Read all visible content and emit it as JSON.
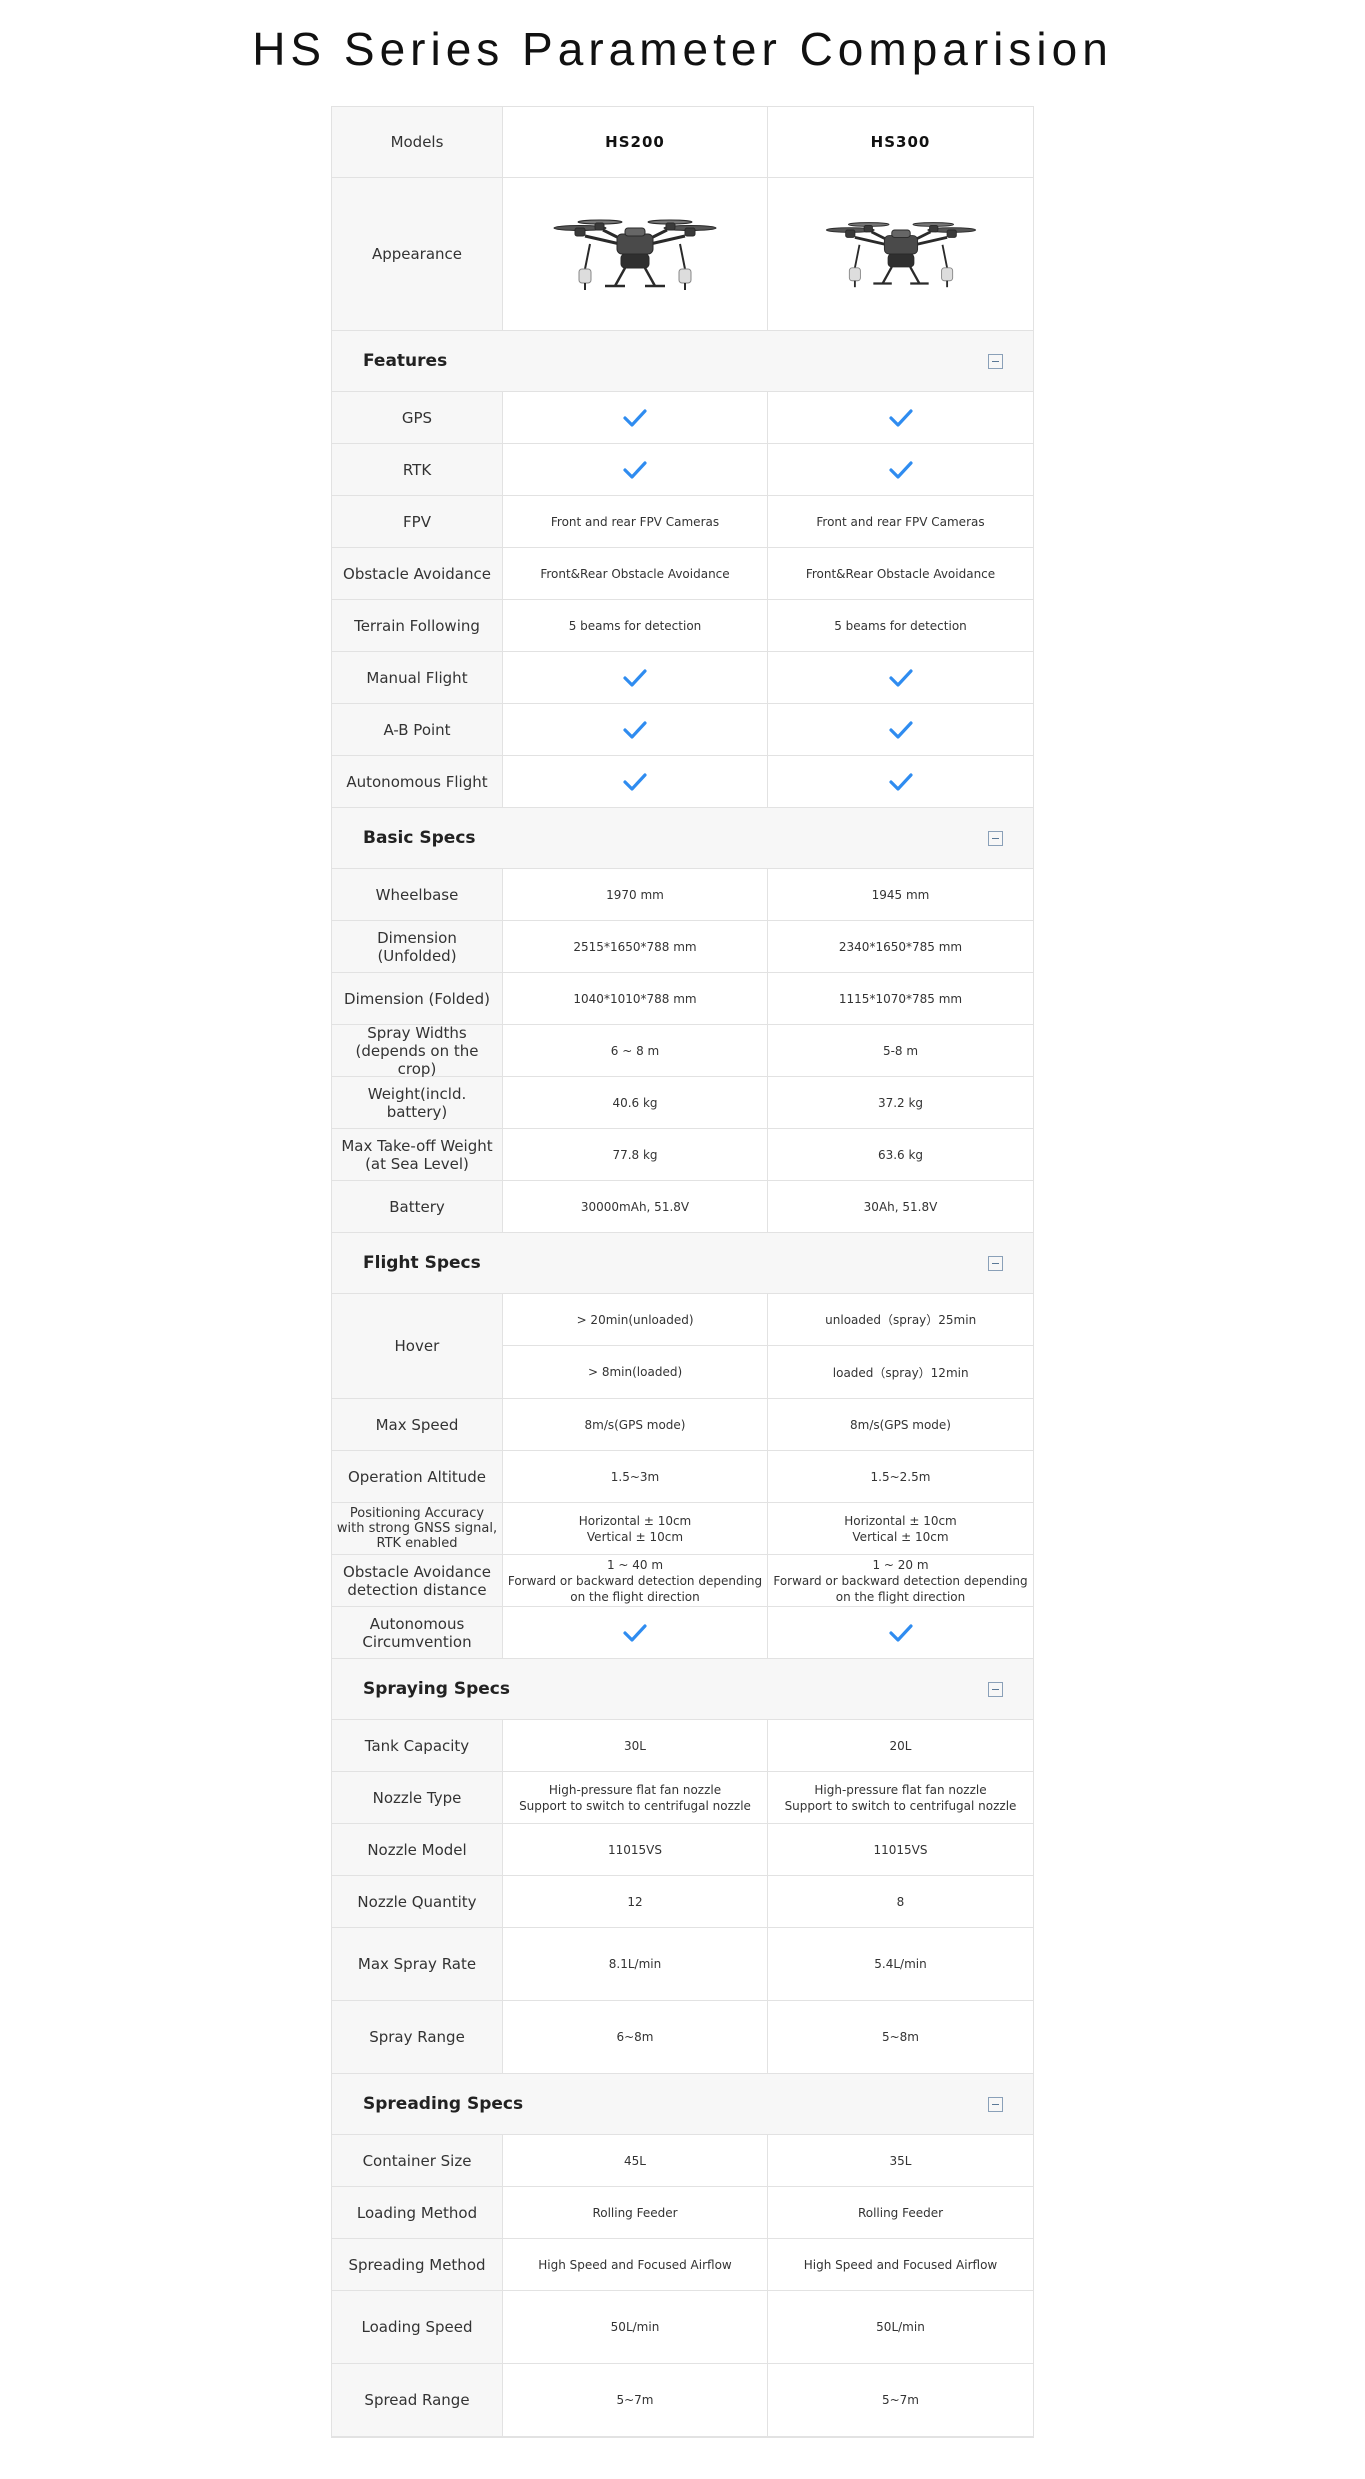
{
  "title": "HS Series Parameter Comparision",
  "header": {
    "label": "Models",
    "models": [
      "HS200",
      "HS300"
    ]
  },
  "appearance": {
    "label": "Appearance"
  },
  "sections": [
    {
      "title": "Features",
      "rows": [
        {
          "label": "GPS",
          "v1": "check",
          "v2": "check"
        },
        {
          "label": "RTK",
          "v1": "check",
          "v2": "check"
        },
        {
          "label": "FPV",
          "v1": "Front and rear FPV Cameras",
          "v2": "Front and rear FPV Cameras"
        },
        {
          "label": "Obstacle Avoidance",
          "v1": "Front&Rear Obstacle Avoidance",
          "v2": "Front&Rear Obstacle Avoidance"
        },
        {
          "label": "Terrain Following",
          "v1": "5 beams for detection",
          "v2": "5 beams for detection"
        },
        {
          "label": "Manual Flight",
          "v1": "check",
          "v2": "check"
        },
        {
          "label": "A-B Point",
          "v1": "check",
          "v2": "check"
        },
        {
          "label": "Autonomous Flight",
          "v1": "check",
          "v2": "check"
        }
      ]
    },
    {
      "title": "Basic Specs",
      "rows": [
        {
          "label": "Wheelbase",
          "v1": "1970 mm",
          "v2": "1945 mm"
        },
        {
          "label": "Dimension (Unfolded)",
          "v1": "2515*1650*788 mm",
          "v2": "2340*1650*785 mm"
        },
        {
          "label": "Dimension (Folded)",
          "v1": "1040*1010*788 mm",
          "v2": "1115*1070*785 mm"
        },
        {
          "label": "Spray Widths\n(depends on the crop)",
          "v1": "6 ~ 8 m",
          "v2": "5-8 m"
        },
        {
          "label": "Weight(incld. battery)",
          "v1": "40.6 kg",
          "v2": "37.2 kg"
        },
        {
          "label": "Max Take-off Weight\n(at Sea Level)",
          "v1": "77.8 kg",
          "v2": "63.6 kg"
        },
        {
          "label": "Battery",
          "v1": "30000mAh, 51.8V",
          "v2": "30Ah, 51.8V"
        }
      ]
    },
    {
      "title": "Flight Specs",
      "rows": [
        {
          "label": "Hover",
          "split": true,
          "v1a": "> 20min(unloaded)",
          "v1b": "> 8min(loaded)",
          "v2a": "unloaded（spray）25min",
          "v2b": "loaded（spray）12min"
        },
        {
          "label": "Max Speed",
          "v1": "8m/s(GPS mode)",
          "v2": "8m/s(GPS mode)"
        },
        {
          "label": "Operation Altitude",
          "v1": "1.5~3m",
          "v2": "1.5~2.5m"
        },
        {
          "label": "Positioning Accuracy with strong GNSS signal, RTK enabled",
          "v1": "Horizontal ± 10cm\nVertical ± 10cm",
          "v2": "Horizontal ± 10cm\nVertical ± 10cm"
        },
        {
          "label": "Obstacle Avoidance detection distance",
          "v1": "1 ~ 40 m\nForward or backward detection depending on the flight direction",
          "v2": "1 ~ 20 m\nForward or backward detection depending on the flight direction"
        },
        {
          "label": "Autonomous Circumvention",
          "v1": "check",
          "v2": "check"
        }
      ]
    },
    {
      "title": "Spraying Specs",
      "rows": [
        {
          "label": "Tank Capacity",
          "v1": "30L",
          "v2": "20L"
        },
        {
          "label": "Nozzle Type",
          "v1": "High-pressure flat fan nozzle\nSupport to switch to centrifugal nozzle",
          "v2": "High-pressure flat fan nozzle\nSupport to switch to centrifugal nozzle"
        },
        {
          "label": "Nozzle Model",
          "v1": "11015VS",
          "v2": "11015VS"
        },
        {
          "label": "Nozzle Quantity",
          "v1": "12",
          "v2": "8"
        },
        {
          "label": "Max Spray Rate",
          "v1": "8.1L/min",
          "v2": "5.4L/min"
        },
        {
          "label": "Spray Range",
          "v1": "6~8m",
          "v2": "5~8m"
        }
      ]
    },
    {
      "title": "Spreading Specs",
      "rows": [
        {
          "label": "Container Size",
          "v1": "45L",
          "v2": "35L"
        },
        {
          "label": "Loading Method",
          "v1": "Rolling Feeder",
          "v2": "Rolling Feeder"
        },
        {
          "label": "Spreading Method",
          "v1": "High Speed and Focused Airflow",
          "v2": "High Speed and Focused Airflow"
        },
        {
          "label": "Loading Speed",
          "v1": "50L/min",
          "v2": "50L/min"
        },
        {
          "label": "Spread Range",
          "v1": "5~7m",
          "v2": "5~7m"
        }
      ]
    }
  ]
}
